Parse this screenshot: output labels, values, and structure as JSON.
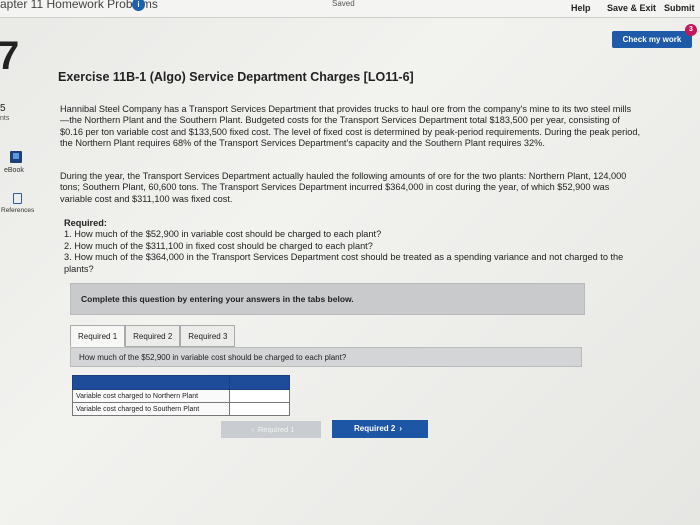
{
  "header": {
    "chapter_title": "apter 11 Homework Problems",
    "chapter_badge": "i",
    "saved_status": "Saved",
    "help": "Help",
    "save_exit": "Save & Exit",
    "submit": "Submit"
  },
  "check": {
    "label": "Check my work",
    "badge": "3"
  },
  "rail": {
    "question_number": "7",
    "points": "5",
    "points_label": "nts",
    "ebook": "eBook",
    "references": "References"
  },
  "exercise": {
    "title": "Exercise 11B-1 (Algo) Service Department Charges [LO11-6]",
    "paragraph1": "Hannibal Steel Company has a Transport Services Department that provides trucks to haul ore from the company's mine to its two steel mills—the Northern Plant and the Southern Plant. Budgeted costs for the Transport Services Department total $183,500 per year, consisting of $0.16 per ton variable cost and $133,500 fixed cost. The level of fixed cost is determined by peak-period requirements. During the peak period, the Northern Plant requires 68% of the Transport Services Department's capacity and the Southern Plant requires 32%.",
    "paragraph2": "During the year, the Transport Services Department actually hauled the following amounts of ore for the two plants: Northern Plant, 124,000 tons; Southern Plant, 60,600 tons. The Transport Services Department incurred $364,000 in cost during the year, of which $52,900 was variable cost and $311,100 was fixed cost.",
    "required_heading": "Required:",
    "required_items": [
      "1. How much of the $52,900 in variable cost should be charged to each plant?",
      "2. How much of the $311,100 in fixed cost should be charged to each plant?",
      "3. How much of the $364,000 in the Transport Services Department cost should be treated as a spending variance and not charged to the plants?"
    ]
  },
  "instruction": "Complete this question by entering your answers in the tabs below.",
  "tabs": [
    {
      "label": "Required 1",
      "active": true
    },
    {
      "label": "Required 2",
      "active": false
    },
    {
      "label": "Required 3",
      "active": false
    }
  ],
  "question": "How much of the $52,900 in variable cost should be charged to each plant?",
  "answer_rows": [
    {
      "label": "Variable cost charged to Northern Plant",
      "value": ""
    },
    {
      "label": "Variable cost charged to Southern Plant",
      "value": ""
    }
  ],
  "nav": {
    "prev": "Required 1",
    "next": "Required 2"
  },
  "colors": {
    "accent": "#1e5aa8",
    "badge": "#c2185b"
  }
}
